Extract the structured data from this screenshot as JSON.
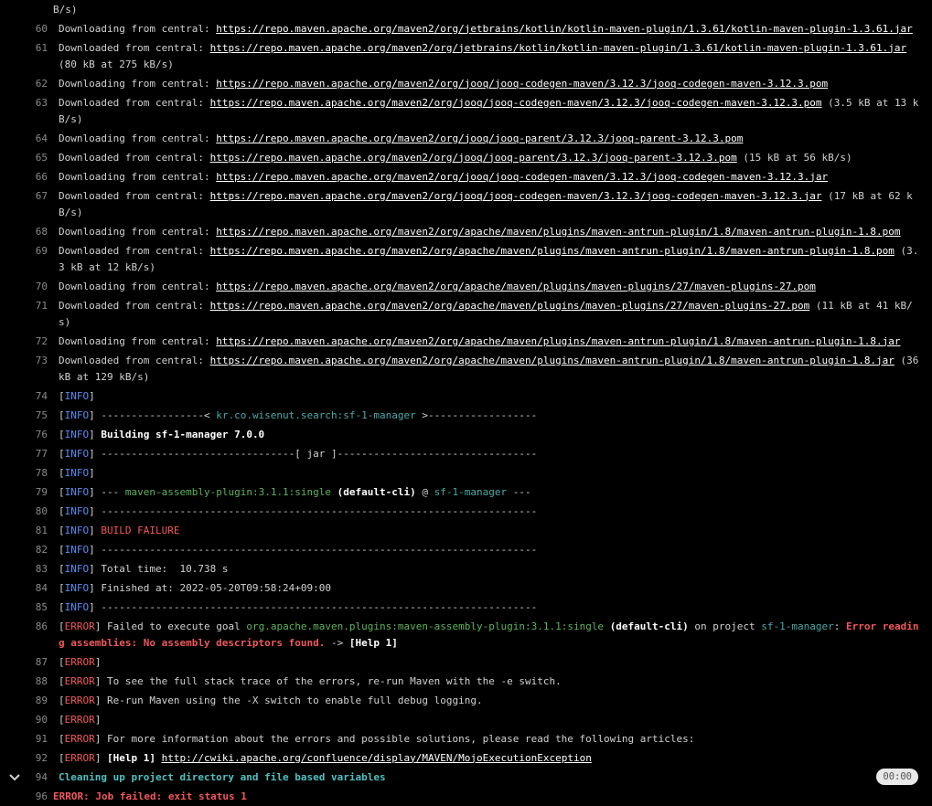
{
  "log": {
    "top_fragment": "B/s)",
    "section_timer": "00:00",
    "lines": [
      {
        "num": "60",
        "prefix": "Downloading from central: ",
        "url": "https://repo.maven.apache.org/maven2/org/jetbrains/kotlin/kotlin-maven-plugin/1.3.61/kotlin-maven-plugin-1.3.61.jar",
        "suffix": ""
      },
      {
        "num": "61",
        "prefix": "Downloaded from central: ",
        "url": "https://repo.maven.apache.org/maven2/org/jetbrains/kotlin/kotlin-maven-plugin/1.3.61/kotlin-maven-plugin-1.3.61.jar",
        "suffix": " (80 kB at 275 kB/s)"
      },
      {
        "num": "62",
        "prefix": "Downloading from central: ",
        "url": "https://repo.maven.apache.org/maven2/org/jooq/jooq-codegen-maven/3.12.3/jooq-codegen-maven-3.12.3.pom",
        "suffix": ""
      },
      {
        "num": "63",
        "prefix": "Downloaded from central: ",
        "url": "https://repo.maven.apache.org/maven2/org/jooq/jooq-codegen-maven/3.12.3/jooq-codegen-maven-3.12.3.pom",
        "suffix": " (3.5 kB at 13 kB/s)"
      },
      {
        "num": "64",
        "prefix": "Downloading from central: ",
        "url": "https://repo.maven.apache.org/maven2/org/jooq/jooq-parent/3.12.3/jooq-parent-3.12.3.pom",
        "suffix": ""
      },
      {
        "num": "65",
        "prefix": "Downloaded from central: ",
        "url": "https://repo.maven.apache.org/maven2/org/jooq/jooq-parent/3.12.3/jooq-parent-3.12.3.pom",
        "suffix": " (15 kB at 56 kB/s)"
      },
      {
        "num": "66",
        "prefix": "Downloading from central: ",
        "url": "https://repo.maven.apache.org/maven2/org/jooq/jooq-codegen-maven/3.12.3/jooq-codegen-maven-3.12.3.jar",
        "suffix": ""
      },
      {
        "num": "67",
        "prefix": "Downloaded from central: ",
        "url": "https://repo.maven.apache.org/maven2/org/jooq/jooq-codegen-maven/3.12.3/jooq-codegen-maven-3.12.3.jar",
        "suffix": " (17 kB at 62 kB/s)"
      },
      {
        "num": "68",
        "prefix": "Downloading from central: ",
        "url": "https://repo.maven.apache.org/maven2/org/apache/maven/plugins/maven-antrun-plugin/1.8/maven-antrun-plugin-1.8.pom",
        "suffix": ""
      },
      {
        "num": "69",
        "prefix": "Downloaded from central: ",
        "url": "https://repo.maven.apache.org/maven2/org/apache/maven/plugins/maven-antrun-plugin/1.8/maven-antrun-plugin-1.8.pom",
        "suffix": " (3.3 kB at 12 kB/s)"
      },
      {
        "num": "70",
        "prefix": "Downloading from central: ",
        "url": "https://repo.maven.apache.org/maven2/org/apache/maven/plugins/maven-plugins/27/maven-plugins-27.pom",
        "suffix": ""
      },
      {
        "num": "71",
        "prefix": "Downloaded from central: ",
        "url": "https://repo.maven.apache.org/maven2/org/apache/maven/plugins/maven-plugins/27/maven-plugins-27.pom",
        "suffix": " (11 kB at 41 kB/s)"
      },
      {
        "num": "72",
        "prefix": "Downloading from central: ",
        "url": "https://repo.maven.apache.org/maven2/org/apache/maven/plugins/maven-antrun-plugin/1.8/maven-antrun-plugin-1.8.jar",
        "suffix": ""
      },
      {
        "num": "73",
        "prefix": "Downloaded from central: ",
        "url": "https://repo.maven.apache.org/maven2/org/apache/maven/plugins/maven-antrun-plugin/1.8/maven-antrun-plugin-1.8.jar",
        "suffix": " (36 kB at 129 kB/s)"
      },
      {
        "num": "74",
        "segs": [
          {
            "t": "[",
            "c": ""
          },
          {
            "t": "INFO",
            "c": "info"
          },
          {
            "t": "]",
            "c": ""
          }
        ]
      },
      {
        "num": "75",
        "segs": [
          {
            "t": "[",
            "c": ""
          },
          {
            "t": "INFO",
            "c": "info"
          },
          {
            "t": "] -----------------< ",
            "c": ""
          },
          {
            "t": "kr.co.wisenut.search:sf-1-manager",
            "c": "cyan"
          },
          {
            "t": " >------------------",
            "c": ""
          }
        ]
      },
      {
        "num": "76",
        "segs": [
          {
            "t": "[",
            "c": ""
          },
          {
            "t": "INFO",
            "c": "info"
          },
          {
            "t": "] ",
            "c": ""
          },
          {
            "t": "Building sf-1-manager 7.0.0",
            "c": "white-bold"
          }
        ]
      },
      {
        "num": "77",
        "segs": [
          {
            "t": "[",
            "c": ""
          },
          {
            "t": "INFO",
            "c": "info"
          },
          {
            "t": "] --------------------------------[ jar ]---------------------------------",
            "c": ""
          }
        ]
      },
      {
        "num": "78",
        "segs": [
          {
            "t": "[",
            "c": ""
          },
          {
            "t": "INFO",
            "c": "info"
          },
          {
            "t": "]",
            "c": ""
          }
        ]
      },
      {
        "num": "79",
        "segs": [
          {
            "t": "[",
            "c": ""
          },
          {
            "t": "INFO",
            "c": "info"
          },
          {
            "t": "] --- ",
            "c": ""
          },
          {
            "t": "maven-assembly-plugin:3.1.1:single",
            "c": "green"
          },
          {
            "t": " ",
            "c": ""
          },
          {
            "t": "(default-cli)",
            "c": "white-bold"
          },
          {
            "t": " @ ",
            "c": ""
          },
          {
            "t": "sf-1-manager",
            "c": "cyan"
          },
          {
            "t": " ---",
            "c": ""
          }
        ]
      },
      {
        "num": "80",
        "segs": [
          {
            "t": "[",
            "c": ""
          },
          {
            "t": "INFO",
            "c": "info"
          },
          {
            "t": "] ------------------------------------------------------------------------",
            "c": ""
          }
        ]
      },
      {
        "num": "81",
        "segs": [
          {
            "t": "[",
            "c": ""
          },
          {
            "t": "INFO",
            "c": "info"
          },
          {
            "t": "] ",
            "c": ""
          },
          {
            "t": "BUILD FAILURE",
            "c": "error"
          }
        ]
      },
      {
        "num": "82",
        "segs": [
          {
            "t": "[",
            "c": ""
          },
          {
            "t": "INFO",
            "c": "info"
          },
          {
            "t": "] ------------------------------------------------------------------------",
            "c": ""
          }
        ]
      },
      {
        "num": "83",
        "segs": [
          {
            "t": "[",
            "c": ""
          },
          {
            "t": "INFO",
            "c": "info"
          },
          {
            "t": "] Total time:  10.738 s",
            "c": ""
          }
        ]
      },
      {
        "num": "84",
        "segs": [
          {
            "t": "[",
            "c": ""
          },
          {
            "t": "INFO",
            "c": "info"
          },
          {
            "t": "] Finished at: 2022-05-20T09:58:24+09:00",
            "c": ""
          }
        ]
      },
      {
        "num": "85",
        "segs": [
          {
            "t": "[",
            "c": ""
          },
          {
            "t": "INFO",
            "c": "info"
          },
          {
            "t": "] ------------------------------------------------------------------------",
            "c": ""
          }
        ]
      },
      {
        "num": "86",
        "segs": [
          {
            "t": "[",
            "c": ""
          },
          {
            "t": "ERROR",
            "c": "error"
          },
          {
            "t": "] Failed to execute goal ",
            "c": ""
          },
          {
            "t": "org.apache.maven.plugins:maven-assembly-plugin:3.1.1:single",
            "c": "green"
          },
          {
            "t": " ",
            "c": ""
          },
          {
            "t": "(default-cli)",
            "c": "white-bold"
          },
          {
            "t": " on project ",
            "c": ""
          },
          {
            "t": "sf-1-manager",
            "c": "cyan"
          },
          {
            "t": ": ",
            "c": ""
          },
          {
            "t": "Error reading assemblies: No assembly descriptors found.",
            "c": "red-bold"
          },
          {
            "t": " -> ",
            "c": ""
          },
          {
            "t": "[Help 1]",
            "c": "white-bold"
          }
        ]
      },
      {
        "num": "87",
        "segs": [
          {
            "t": "[",
            "c": ""
          },
          {
            "t": "ERROR",
            "c": "error"
          },
          {
            "t": "]",
            "c": ""
          }
        ]
      },
      {
        "num": "88",
        "segs": [
          {
            "t": "[",
            "c": ""
          },
          {
            "t": "ERROR",
            "c": "error"
          },
          {
            "t": "] To see the full stack trace of the errors, re-run Maven with the -e switch.",
            "c": ""
          }
        ]
      },
      {
        "num": "89",
        "segs": [
          {
            "t": "[",
            "c": ""
          },
          {
            "t": "ERROR",
            "c": "error"
          },
          {
            "t": "] Re-run Maven using the -X switch to enable full debug logging.",
            "c": ""
          }
        ]
      },
      {
        "num": "90",
        "segs": [
          {
            "t": "[",
            "c": ""
          },
          {
            "t": "ERROR",
            "c": "error"
          },
          {
            "t": "]",
            "c": ""
          }
        ]
      },
      {
        "num": "91",
        "segs": [
          {
            "t": "[",
            "c": ""
          },
          {
            "t": "ERROR",
            "c": "error"
          },
          {
            "t": "] For more information about the errors and possible solutions, please read the following articles:",
            "c": ""
          }
        ]
      },
      {
        "num": "92",
        "segs": [
          {
            "t": "[",
            "c": ""
          },
          {
            "t": "ERROR",
            "c": "error"
          },
          {
            "t": "] ",
            "c": ""
          },
          {
            "t": "[Help 1]",
            "c": "white-bold"
          },
          {
            "t": " ",
            "c": ""
          },
          {
            "t": "http://cwiki.apache.org/confluence/display/MAVEN/MojoExecutionException",
            "c": "link"
          }
        ]
      },
      {
        "num": "94",
        "section": true,
        "segs": [
          {
            "t": "Cleaning up project directory and file based variables",
            "c": "section"
          }
        ]
      },
      {
        "num": "96",
        "nolead": true,
        "segs": [
          {
            "t": "ERROR: Job failed: exit status 1",
            "c": "red-bold"
          }
        ]
      }
    ]
  },
  "colors": {
    "info": "#5a8dee",
    "error": "#f0585c",
    "green": "#5fb35f",
    "cyan": "#4ea8a8",
    "section": "#4ec1c1"
  }
}
